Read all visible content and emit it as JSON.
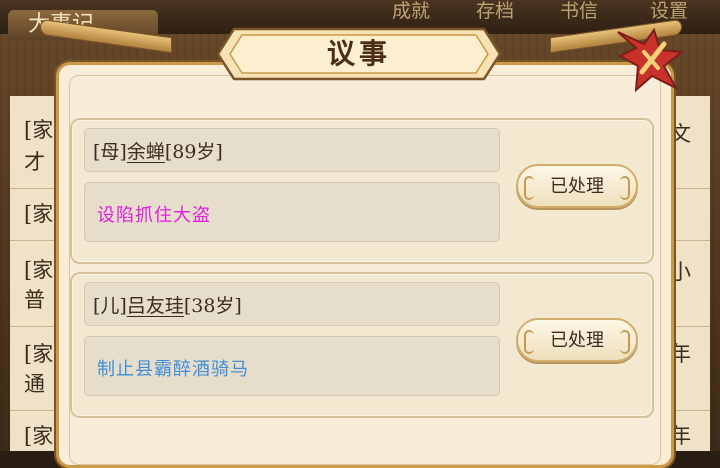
{
  "background": {
    "tabs": [
      "成就",
      "存档",
      "书信",
      "设置"
    ],
    "panel_title": "大事记",
    "rows": [
      {
        "left": "[家",
        "left2": "才",
        "right": "文"
      },
      {
        "left": "[家",
        "left2": "",
        "right": ""
      },
      {
        "left": "[家",
        "left2": "普",
        "right": "小"
      },
      {
        "left": "[家",
        "left2": "通",
        "right": "年"
      },
      {
        "left": "[家",
        "left2": "",
        "right": "年"
      }
    ]
  },
  "dialog": {
    "title": "议事",
    "cards": [
      {
        "relation": "[母]",
        "name": "余蝉",
        "age": "[89岁]",
        "event": "设陷抓住大盗",
        "event_color": "#e01ee0",
        "button": "已处理"
      },
      {
        "relation": "[儿]",
        "name": "吕友珪",
        "age": "[38岁]",
        "event": "制止县霸醉酒骑马",
        "event_color": "#3f8fd8",
        "button": "已处理"
      }
    ]
  },
  "colors": {
    "frame": "#c99a4a",
    "panel": "#f7edd8",
    "close_red": "#c8322a"
  }
}
